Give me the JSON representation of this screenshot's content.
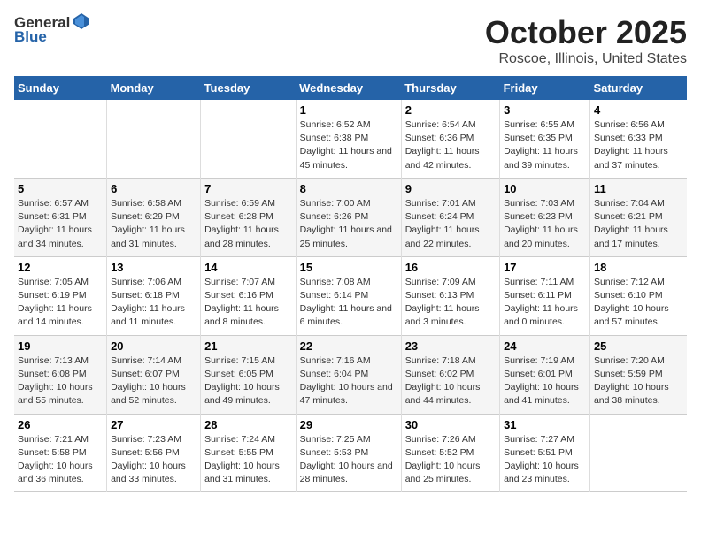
{
  "header": {
    "logo_general": "General",
    "logo_blue": "Blue",
    "month": "October 2025",
    "location": "Roscoe, Illinois, United States"
  },
  "days_of_week": [
    "Sunday",
    "Monday",
    "Tuesday",
    "Wednesday",
    "Thursday",
    "Friday",
    "Saturday"
  ],
  "weeks": [
    [
      {
        "day": "",
        "sunrise": "",
        "sunset": "",
        "daylight": ""
      },
      {
        "day": "",
        "sunrise": "",
        "sunset": "",
        "daylight": ""
      },
      {
        "day": "",
        "sunrise": "",
        "sunset": "",
        "daylight": ""
      },
      {
        "day": "1",
        "sunrise": "Sunrise: 6:52 AM",
        "sunset": "Sunset: 6:38 PM",
        "daylight": "Daylight: 11 hours and 45 minutes."
      },
      {
        "day": "2",
        "sunrise": "Sunrise: 6:54 AM",
        "sunset": "Sunset: 6:36 PM",
        "daylight": "Daylight: 11 hours and 42 minutes."
      },
      {
        "day": "3",
        "sunrise": "Sunrise: 6:55 AM",
        "sunset": "Sunset: 6:35 PM",
        "daylight": "Daylight: 11 hours and 39 minutes."
      },
      {
        "day": "4",
        "sunrise": "Sunrise: 6:56 AM",
        "sunset": "Sunset: 6:33 PM",
        "daylight": "Daylight: 11 hours and 37 minutes."
      }
    ],
    [
      {
        "day": "5",
        "sunrise": "Sunrise: 6:57 AM",
        "sunset": "Sunset: 6:31 PM",
        "daylight": "Daylight: 11 hours and 34 minutes."
      },
      {
        "day": "6",
        "sunrise": "Sunrise: 6:58 AM",
        "sunset": "Sunset: 6:29 PM",
        "daylight": "Daylight: 11 hours and 31 minutes."
      },
      {
        "day": "7",
        "sunrise": "Sunrise: 6:59 AM",
        "sunset": "Sunset: 6:28 PM",
        "daylight": "Daylight: 11 hours and 28 minutes."
      },
      {
        "day": "8",
        "sunrise": "Sunrise: 7:00 AM",
        "sunset": "Sunset: 6:26 PM",
        "daylight": "Daylight: 11 hours and 25 minutes."
      },
      {
        "day": "9",
        "sunrise": "Sunrise: 7:01 AM",
        "sunset": "Sunset: 6:24 PM",
        "daylight": "Daylight: 11 hours and 22 minutes."
      },
      {
        "day": "10",
        "sunrise": "Sunrise: 7:03 AM",
        "sunset": "Sunset: 6:23 PM",
        "daylight": "Daylight: 11 hours and 20 minutes."
      },
      {
        "day": "11",
        "sunrise": "Sunrise: 7:04 AM",
        "sunset": "Sunset: 6:21 PM",
        "daylight": "Daylight: 11 hours and 17 minutes."
      }
    ],
    [
      {
        "day": "12",
        "sunrise": "Sunrise: 7:05 AM",
        "sunset": "Sunset: 6:19 PM",
        "daylight": "Daylight: 11 hours and 14 minutes."
      },
      {
        "day": "13",
        "sunrise": "Sunrise: 7:06 AM",
        "sunset": "Sunset: 6:18 PM",
        "daylight": "Daylight: 11 hours and 11 minutes."
      },
      {
        "day": "14",
        "sunrise": "Sunrise: 7:07 AM",
        "sunset": "Sunset: 6:16 PM",
        "daylight": "Daylight: 11 hours and 8 minutes."
      },
      {
        "day": "15",
        "sunrise": "Sunrise: 7:08 AM",
        "sunset": "Sunset: 6:14 PM",
        "daylight": "Daylight: 11 hours and 6 minutes."
      },
      {
        "day": "16",
        "sunrise": "Sunrise: 7:09 AM",
        "sunset": "Sunset: 6:13 PM",
        "daylight": "Daylight: 11 hours and 3 minutes."
      },
      {
        "day": "17",
        "sunrise": "Sunrise: 7:11 AM",
        "sunset": "Sunset: 6:11 PM",
        "daylight": "Daylight: 11 hours and 0 minutes."
      },
      {
        "day": "18",
        "sunrise": "Sunrise: 7:12 AM",
        "sunset": "Sunset: 6:10 PM",
        "daylight": "Daylight: 10 hours and 57 minutes."
      }
    ],
    [
      {
        "day": "19",
        "sunrise": "Sunrise: 7:13 AM",
        "sunset": "Sunset: 6:08 PM",
        "daylight": "Daylight: 10 hours and 55 minutes."
      },
      {
        "day": "20",
        "sunrise": "Sunrise: 7:14 AM",
        "sunset": "Sunset: 6:07 PM",
        "daylight": "Daylight: 10 hours and 52 minutes."
      },
      {
        "day": "21",
        "sunrise": "Sunrise: 7:15 AM",
        "sunset": "Sunset: 6:05 PM",
        "daylight": "Daylight: 10 hours and 49 minutes."
      },
      {
        "day": "22",
        "sunrise": "Sunrise: 7:16 AM",
        "sunset": "Sunset: 6:04 PM",
        "daylight": "Daylight: 10 hours and 47 minutes."
      },
      {
        "day": "23",
        "sunrise": "Sunrise: 7:18 AM",
        "sunset": "Sunset: 6:02 PM",
        "daylight": "Daylight: 10 hours and 44 minutes."
      },
      {
        "day": "24",
        "sunrise": "Sunrise: 7:19 AM",
        "sunset": "Sunset: 6:01 PM",
        "daylight": "Daylight: 10 hours and 41 minutes."
      },
      {
        "day": "25",
        "sunrise": "Sunrise: 7:20 AM",
        "sunset": "Sunset: 5:59 PM",
        "daylight": "Daylight: 10 hours and 38 minutes."
      }
    ],
    [
      {
        "day": "26",
        "sunrise": "Sunrise: 7:21 AM",
        "sunset": "Sunset: 5:58 PM",
        "daylight": "Daylight: 10 hours and 36 minutes."
      },
      {
        "day": "27",
        "sunrise": "Sunrise: 7:23 AM",
        "sunset": "Sunset: 5:56 PM",
        "daylight": "Daylight: 10 hours and 33 minutes."
      },
      {
        "day": "28",
        "sunrise": "Sunrise: 7:24 AM",
        "sunset": "Sunset: 5:55 PM",
        "daylight": "Daylight: 10 hours and 31 minutes."
      },
      {
        "day": "29",
        "sunrise": "Sunrise: 7:25 AM",
        "sunset": "Sunset: 5:53 PM",
        "daylight": "Daylight: 10 hours and 28 minutes."
      },
      {
        "day": "30",
        "sunrise": "Sunrise: 7:26 AM",
        "sunset": "Sunset: 5:52 PM",
        "daylight": "Daylight: 10 hours and 25 minutes."
      },
      {
        "day": "31",
        "sunrise": "Sunrise: 7:27 AM",
        "sunset": "Sunset: 5:51 PM",
        "daylight": "Daylight: 10 hours and 23 minutes."
      },
      {
        "day": "",
        "sunrise": "",
        "sunset": "",
        "daylight": ""
      }
    ]
  ]
}
